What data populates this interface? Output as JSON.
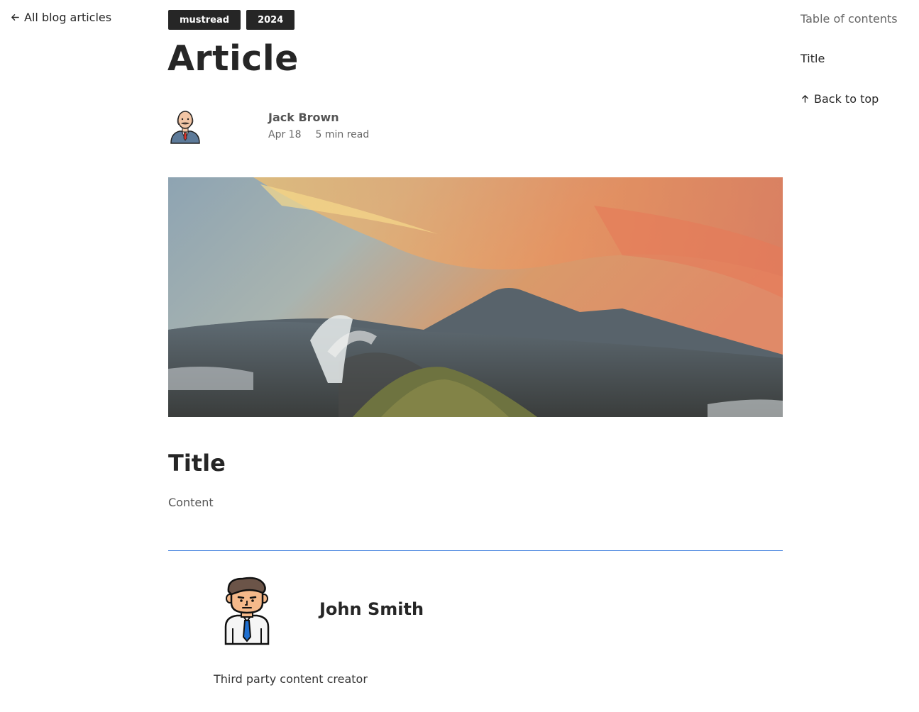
{
  "nav": {
    "back_label": "All blog articles"
  },
  "tags": [
    "mustread",
    "2024"
  ],
  "article": {
    "title": "Article",
    "author": {
      "name": "Jack Brown",
      "date": "Apr 18",
      "read_time": "5 min read"
    },
    "section_title": "Title",
    "section_content": "Content"
  },
  "creator": {
    "name": "John Smith",
    "role": "Third party content creator"
  },
  "toc": {
    "heading": "Table of contents",
    "items": [
      "Title"
    ],
    "back_to_top": "Back to top"
  },
  "colors": {
    "tag_bg": "#262626",
    "divider": "#3b7ddd"
  },
  "icons": {
    "back": "arrow-left-icon",
    "top": "arrow-up-icon"
  }
}
